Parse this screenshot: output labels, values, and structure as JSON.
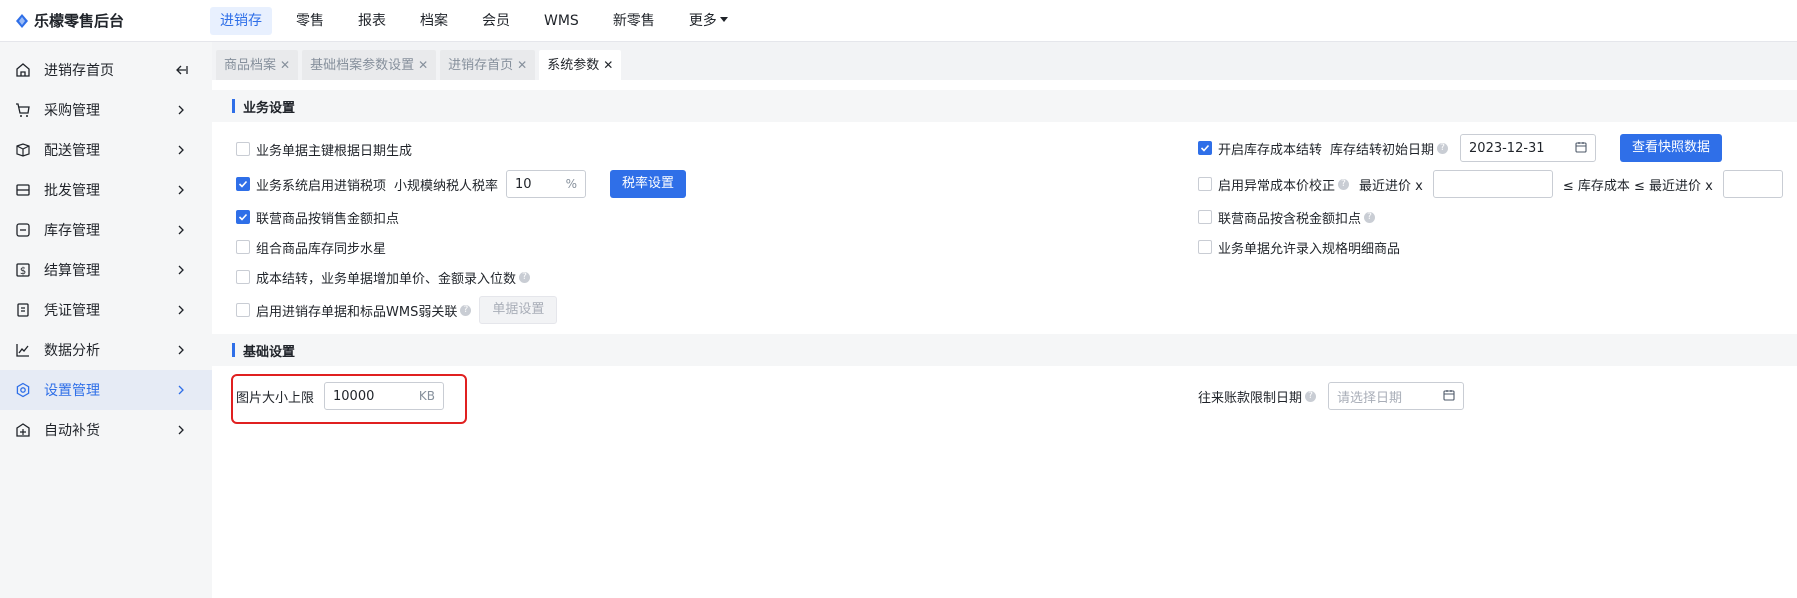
{
  "app": {
    "title": "乐檬零售后台"
  },
  "topnav": [
    {
      "label": "进销存",
      "active": true
    },
    {
      "label": "零售"
    },
    {
      "label": "报表"
    },
    {
      "label": "档案"
    },
    {
      "label": "会员"
    },
    {
      "label": "WMS"
    },
    {
      "label": "新零售"
    },
    {
      "label": "更多"
    }
  ],
  "sidebar": {
    "items": [
      {
        "label": "进销存首页",
        "icon": "home-icon",
        "trailing": "collapse-icon"
      },
      {
        "label": "采购管理",
        "icon": "cart-icon"
      },
      {
        "label": "配送管理",
        "icon": "delivery-icon"
      },
      {
        "label": "批发管理",
        "icon": "wholesale-icon"
      },
      {
        "label": "库存管理",
        "icon": "inventory-icon"
      },
      {
        "label": "结算管理",
        "icon": "settlement-icon"
      },
      {
        "label": "凭证管理",
        "icon": "voucher-icon"
      },
      {
        "label": "数据分析",
        "icon": "analytics-icon"
      },
      {
        "label": "设置管理",
        "icon": "settings-icon",
        "active": true
      },
      {
        "label": "自动补货",
        "icon": "restock-icon"
      }
    ]
  },
  "tabs": [
    {
      "label": "商品档案"
    },
    {
      "label": "基础档案参数设置"
    },
    {
      "label": "进销存首页"
    },
    {
      "label": "系统参数",
      "active": true
    }
  ],
  "business": {
    "title": "业务设置",
    "opt_date_key": "业务单据主键根据日期生成",
    "opt_tax": "业务系统启用进销税项",
    "tax_rate_label": "小规模纳税人税率",
    "tax_rate_value": "10",
    "tax_rate_unit": "%",
    "tax_btn": "税率设置",
    "opt_joint_discount": "联营商品按销售金额扣点",
    "opt_combo_sync": "组合商品库存同步水星",
    "opt_cost_digits": "成本结转，业务单据增加单价、金额录入位数",
    "opt_wms": "启用进销存单据和标品WMS弱关联",
    "wms_btn": "单据设置",
    "opt_cost_carry": "开启库存成本结转",
    "carry_date_label": "库存结转初始日期",
    "carry_date_value": "2023-12-31",
    "snapshot_btn": "查看快照数据",
    "opt_abnormal": "启用异常成本价校正",
    "recent_price_label": "最近进价 x",
    "cost_range_label": "≤ 库存成本 ≤ 最近进价 x",
    "opt_joint_tax": "联营商品按含税金额扣点",
    "opt_spec": "业务单据允许录入规格明细商品"
  },
  "basic": {
    "title": "基础设置",
    "image_limit_label": "图片大小上限",
    "image_limit_value": "10000",
    "image_limit_unit": "KB",
    "ar_date_label": "往来账款限制日期",
    "ar_date_placeholder": "请选择日期"
  },
  "colors": {
    "accent": "#2f6fe8",
    "highlight": "#e02020"
  }
}
